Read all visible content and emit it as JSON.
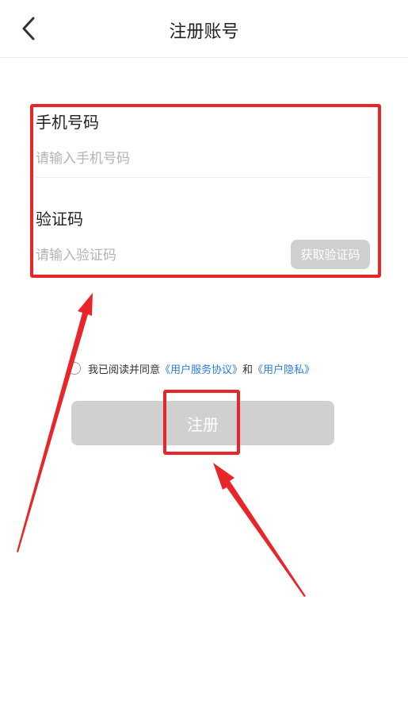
{
  "header": {
    "title": "注册账号",
    "back_icon": "chevron-left-icon"
  },
  "form": {
    "phone": {
      "label": "手机号码",
      "placeholder": "请输入手机号码",
      "value": ""
    },
    "code": {
      "label": "验证码",
      "placeholder": "请输入验证码",
      "value": "",
      "get_code_label": "获取验证码"
    }
  },
  "agreement": {
    "prefix": "我已阅读并同意",
    "service_link": "《用户服务协议》",
    "conjunction": "和",
    "privacy_link": "《用户隐私》",
    "checked": false
  },
  "register_label": "注册",
  "colors": {
    "accent_link": "#2a7de1",
    "annotation": "#e8262a",
    "disabled_button": "#d0d0d0"
  }
}
